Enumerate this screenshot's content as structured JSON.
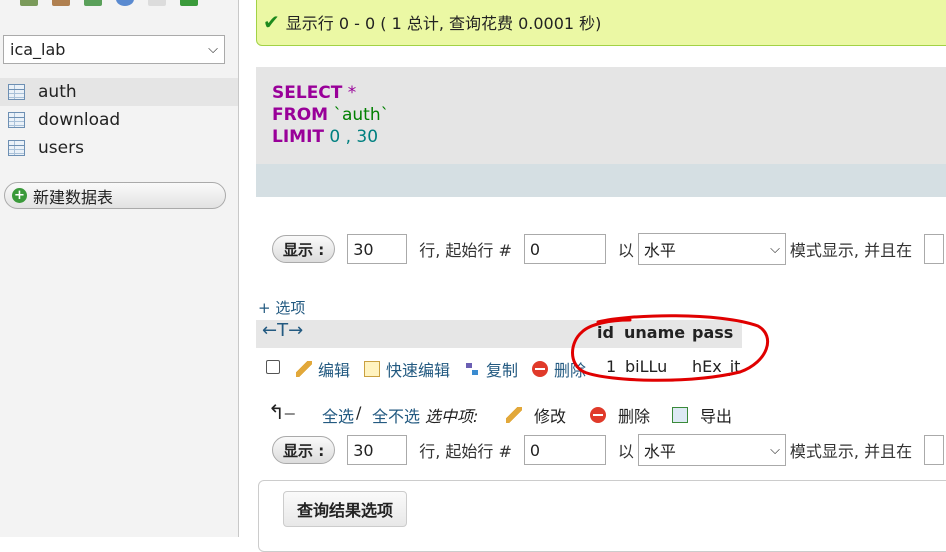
{
  "left": {
    "db_select": "ica_lab",
    "tables": [
      "auth",
      "download",
      "users"
    ],
    "new_table_label": "新建数据表"
  },
  "success": {
    "message": "显示行 0 - 0 ( 1 总计, 查询花费 0.0001 秒)"
  },
  "sql": {
    "select_kw": "SELECT",
    "star": " *",
    "from_kw": "FROM",
    "table": " `auth`",
    "limit_kw": "LIMIT",
    "limit_vals": " 0 , 30"
  },
  "nav": {
    "show_button": "显示 :",
    "rows_value": "30",
    "rows_start_label": "行, 起始行 #",
    "start_value": "0",
    "with_label": "以",
    "mode_value": "水平",
    "mode_label": "模式显示, 并且在"
  },
  "options_link": "+ 选项",
  "result": {
    "arrows": "←T→",
    "headers": [
      "id",
      "uname",
      "pass"
    ],
    "row": {
      "edit": "编辑",
      "quick_edit": "快速编辑",
      "copy": "复制",
      "delete": "删除",
      "id": "1",
      "uname": "biLLu",
      "pass": "hEx_it"
    }
  },
  "bulk": {
    "select_all": "全选",
    "sep": " / ",
    "deselect_all": "全不选",
    "selected_label": "选中项:",
    "modify": "修改",
    "delete": "删除",
    "export": "导出"
  },
  "result_options_label": "查询结果选项",
  "colors": {
    "success_bg": "#ebf8a4",
    "keyword": "#990099",
    "link": "#235a81",
    "annotation": "#e00000"
  }
}
